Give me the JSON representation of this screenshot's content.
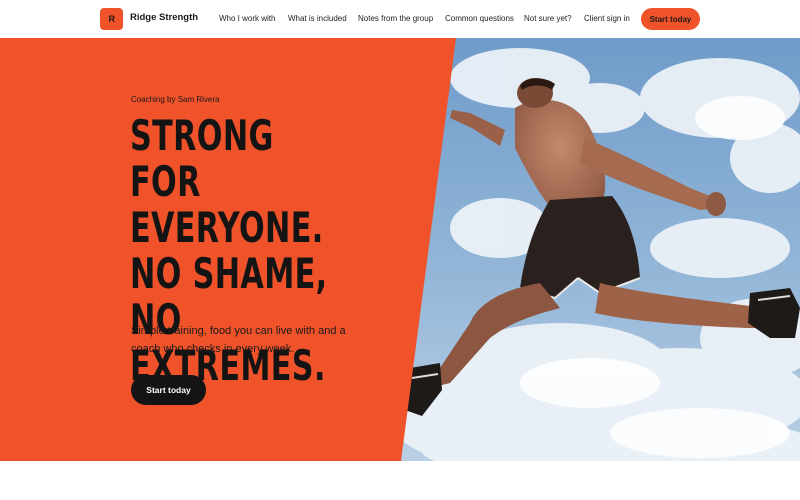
{
  "brand": {
    "mark": "R",
    "name": "Ridge Strength",
    "accent_color": "#f0522a",
    "dark_color": "#141414"
  },
  "nav": {
    "items": [
      {
        "label": "Who I work with"
      },
      {
        "label": "What is included"
      },
      {
        "label": "Notes from the group"
      },
      {
        "label": "Common questions"
      },
      {
        "label": "Not sure yet?"
      },
      {
        "label": "Client sign in"
      }
    ],
    "cta_label": "Start today"
  },
  "hero": {
    "eyebrow": "Coaching by Sam Rivera",
    "headline": "Strong for everyone. No shame, no extremes.",
    "subcopy": "Simple training, food you can live with and a coach who checks in every week.",
    "cta_label": "Start today",
    "image_subject": "shirtless-man-leaping-against-sky"
  }
}
